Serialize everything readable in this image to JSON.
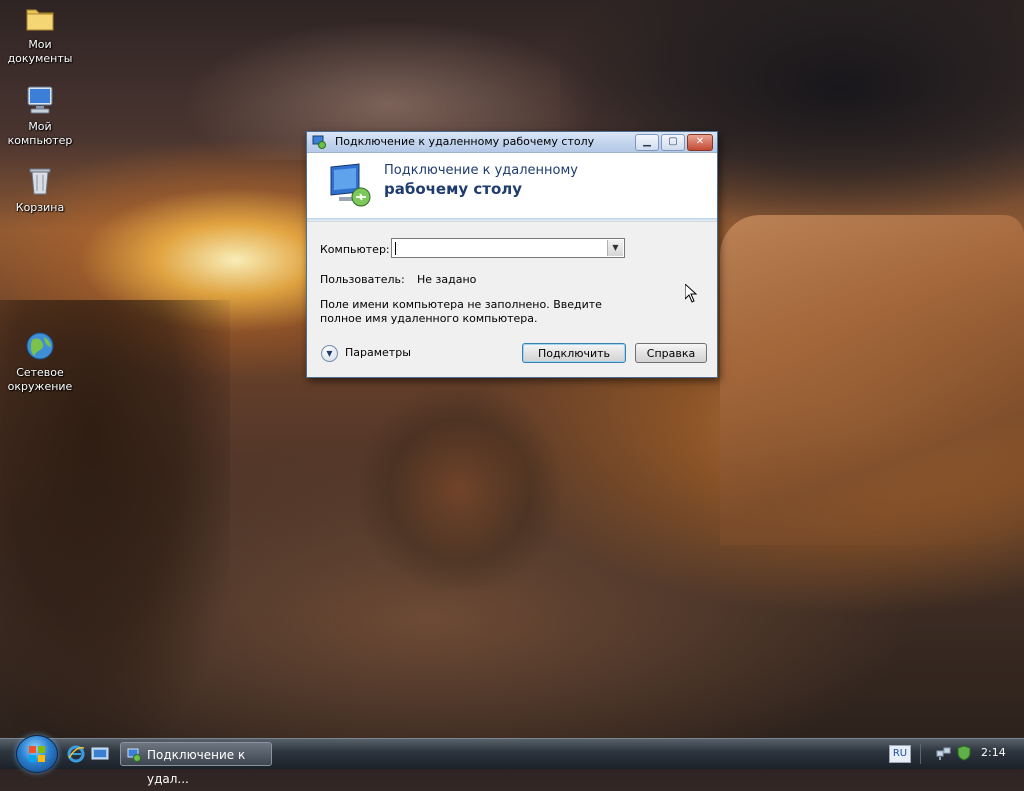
{
  "desktop": {
    "icons": [
      {
        "label_line1": "Мои",
        "label_line2": "документы",
        "icon": "folder-icon"
      },
      {
        "label_line1": "Мой",
        "label_line2": "компьютер",
        "icon": "computer-icon"
      },
      {
        "label_line1": "Корзина",
        "label_line2": "",
        "icon": "recycle-bin-icon"
      },
      {
        "label_line1": "Сетевое",
        "label_line2": "окружение",
        "icon": "network-globe-icon"
      }
    ]
  },
  "dialog": {
    "title": "Подключение к удаленному рабочему столу",
    "banner_line1": "Подключение к удаленному",
    "banner_line2": "рабочему столу",
    "computer_label": "Компьютер:",
    "computer_value": "",
    "user_label": "Пользователь:",
    "user_value": "Не задано",
    "message": "Поле имени компьютера не заполнено. Введите полное имя удаленного компьютера.",
    "options_label": "Параметры",
    "connect_button": "Подключить",
    "help_button": "Справка",
    "window_buttons": {
      "minimize": "▁",
      "maximize": "▢",
      "close": "✕"
    }
  },
  "taskbar": {
    "task_label": "Подключение к удал...",
    "language": "RU",
    "clock": "2:14",
    "quicklaunch": [
      "internet-explorer-icon",
      "show-desktop-icon"
    ]
  },
  "colors": {
    "title_text": "#000000",
    "banner_text": "#1f3c6e",
    "taskbar": "#2e3640"
  }
}
